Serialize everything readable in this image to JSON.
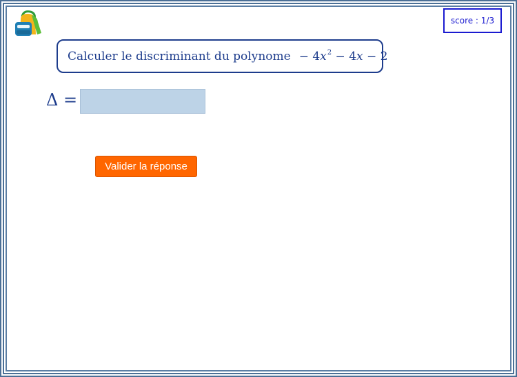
{
  "score": {
    "label": "score : 1/3"
  },
  "question": {
    "text": "Calculer le discriminant du polynome",
    "polynomial": {
      "term1": "− 4",
      "var1": "x",
      "exp1": "2",
      "term2": " − 4",
      "var2": "x",
      "term3": " − 2"
    }
  },
  "answer": {
    "label": "Δ =",
    "value": "",
    "placeholder": ""
  },
  "validate_button": {
    "label": "Valider la réponse"
  },
  "colors": {
    "border": "#4b6f96",
    "score": "#1a1ad0",
    "question": "#1d3c8c",
    "input_bg": "#bdd3e7",
    "button": "#ff6600"
  },
  "icons": {
    "logo": "backpack-icon"
  }
}
